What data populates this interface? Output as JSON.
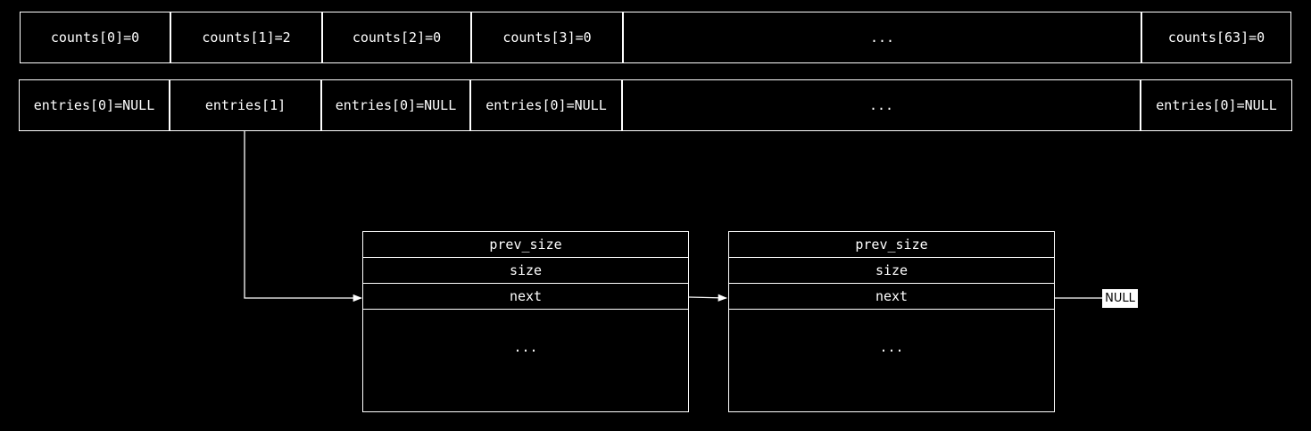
{
  "counts": [
    "counts[0]=0",
    "counts[1]=2",
    "counts[2]=0",
    "counts[3]=0",
    "...",
    "counts[63]=0"
  ],
  "entries": [
    "entries[0]=NULL",
    "entries[1]",
    "entries[0]=NULL",
    "entries[0]=NULL",
    "...",
    "entries[0]=NULL"
  ],
  "chunks": [
    {
      "prev_size": "prev_size",
      "size": "size",
      "next": "next",
      "rest": "..."
    },
    {
      "prev_size": "prev_size",
      "size": "size",
      "next": "next",
      "rest": "..."
    }
  ],
  "null_label": "NULL",
  "colors": {
    "background": "#000000",
    "line": "#ffffff",
    "text": "#ffffff"
  }
}
